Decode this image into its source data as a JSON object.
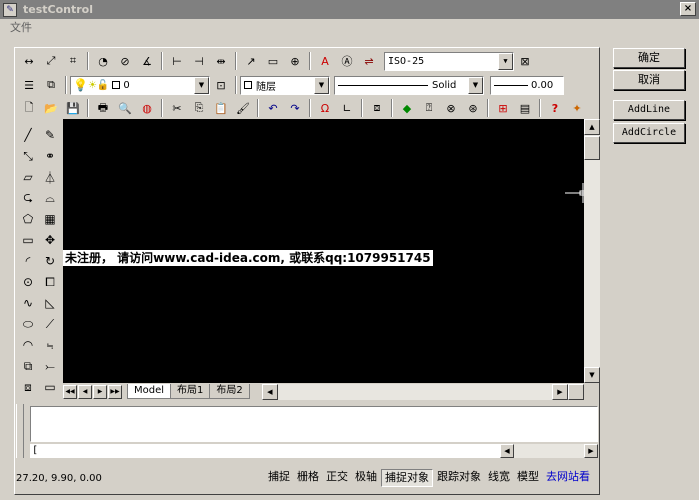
{
  "window": {
    "title": "testControl",
    "close_glyph": "×"
  },
  "menu": {
    "file": "文件"
  },
  "toolbar": {
    "dimstyle": "ISO-25",
    "layer": "0",
    "color": "随层",
    "linetype": "Solid",
    "lineweight": "0.00"
  },
  "right_buttons": {
    "ok": "确定",
    "cancel": "取消",
    "add_line": "AddLine",
    "add_circle": "AddCircle"
  },
  "canvas": {
    "watermark": "未注册，  请访问www.cad-idea.com, 或联系qq:1079951745"
  },
  "tabs": [
    "Model",
    "布局1",
    "布局2"
  ],
  "command": {
    "prompt": "["
  },
  "status": {
    "coords": "27.20, 9.90, 0.00",
    "toggles": [
      "捕捉",
      "栅格",
      "正交",
      "极轴",
      "捕捉对象",
      "跟踪对象",
      "线宽",
      "模型"
    ],
    "active_toggles": [
      4
    ],
    "link": "去网站看"
  },
  "colors": {
    "canvas": "#000000",
    "link": "#0000cc",
    "chrome": "#d4d0c8"
  },
  "icons": {
    "row1": [
      "dim-linear-icon",
      "dim-aligned-icon",
      "dim-ordinate-icon",
      "dim-radius-icon",
      "dim-diameter-icon",
      "dim-angular-icon",
      "dim-baseline-icon",
      "dim-continue-icon",
      "dim-quick-icon",
      "leader-icon",
      "tolerance-icon",
      "center-mark-icon",
      "dim-edit-icon",
      "dim-text-edit-icon",
      "dim-update-icon",
      "dim-style-icon"
    ],
    "row3": [
      "new-icon",
      "open-icon",
      "save-icon",
      "print-icon",
      "preview-icon",
      "publish-icon",
      "cut-icon",
      "copy-icon",
      "paste-icon",
      "matchprop-icon",
      "undo-icon",
      "redo-icon",
      "pan-icon",
      "ucs-icon",
      "zoom-realtime-icon",
      "zoom-window-icon",
      "zoom-previous-icon",
      "properties-icon",
      "design-center-icon",
      "help-icon",
      "whats-new-icon"
    ]
  }
}
